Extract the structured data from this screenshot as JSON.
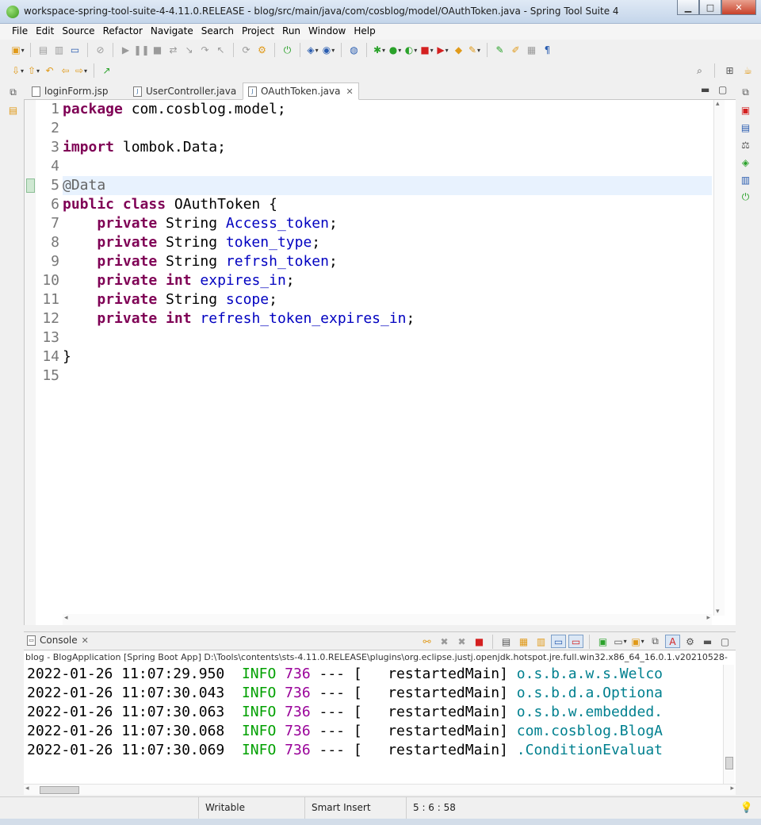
{
  "window": {
    "title": "workspace-spring-tool-suite-4-4.11.0.RELEASE - blog/src/main/java/com/cosblog/model/OAuthToken.java - Spring Tool Suite 4",
    "minimize": "0",
    "maximize": "□",
    "close": "✕"
  },
  "menu": [
    "File",
    "Edit",
    "Source",
    "Refactor",
    "Navigate",
    "Search",
    "Project",
    "Run",
    "Window",
    "Help"
  ],
  "editor": {
    "tabs": [
      {
        "label": "loginForm.jsp",
        "active": false
      },
      {
        "label": "UserController.java",
        "active": false
      },
      {
        "label": "OAuthToken.java",
        "active": true
      }
    ],
    "current_line": 5,
    "lines": [
      {
        "n": "1",
        "tokens": [
          {
            "t": "package",
            "c": "kw"
          },
          {
            "t": " com.cosblog.model;",
            "c": ""
          }
        ]
      },
      {
        "n": "2",
        "tokens": []
      },
      {
        "n": "3",
        "tokens": [
          {
            "t": "import",
            "c": "kw"
          },
          {
            "t": " lombok.Data;",
            "c": ""
          }
        ]
      },
      {
        "n": "4",
        "tokens": []
      },
      {
        "n": "5",
        "tokens": [
          {
            "t": "@Data",
            "c": "ann"
          }
        ]
      },
      {
        "n": "6",
        "tokens": [
          {
            "t": "public",
            "c": "kw"
          },
          {
            "t": " ",
            "c": ""
          },
          {
            "t": "class",
            "c": "kw"
          },
          {
            "t": " OAuthToken {",
            "c": ""
          }
        ]
      },
      {
        "n": "7",
        "tokens": [
          {
            "t": "    ",
            "c": ""
          },
          {
            "t": "private",
            "c": "kw"
          },
          {
            "t": " String ",
            "c": ""
          },
          {
            "t": "Access_token",
            "c": "fld"
          },
          {
            "t": ";",
            "c": ""
          }
        ]
      },
      {
        "n": "8",
        "tokens": [
          {
            "t": "    ",
            "c": ""
          },
          {
            "t": "private",
            "c": "kw"
          },
          {
            "t": " String ",
            "c": ""
          },
          {
            "t": "token_type",
            "c": "fld"
          },
          {
            "t": ";",
            "c": ""
          }
        ]
      },
      {
        "n": "9",
        "tokens": [
          {
            "t": "    ",
            "c": ""
          },
          {
            "t": "private",
            "c": "kw"
          },
          {
            "t": " String ",
            "c": ""
          },
          {
            "t": "refrsh_token",
            "c": "fld"
          },
          {
            "t": ";",
            "c": ""
          }
        ]
      },
      {
        "n": "10",
        "tokens": [
          {
            "t": "    ",
            "c": ""
          },
          {
            "t": "private",
            "c": "kw"
          },
          {
            "t": " ",
            "c": ""
          },
          {
            "t": "int",
            "c": "kw"
          },
          {
            "t": " ",
            "c": ""
          },
          {
            "t": "expires_in",
            "c": "fld"
          },
          {
            "t": ";",
            "c": ""
          }
        ]
      },
      {
        "n": "11",
        "tokens": [
          {
            "t": "    ",
            "c": ""
          },
          {
            "t": "private",
            "c": "kw"
          },
          {
            "t": " String ",
            "c": ""
          },
          {
            "t": "scope",
            "c": "fld"
          },
          {
            "t": ";",
            "c": ""
          }
        ]
      },
      {
        "n": "12",
        "tokens": [
          {
            "t": "    ",
            "c": ""
          },
          {
            "t": "private",
            "c": "kw"
          },
          {
            "t": " ",
            "c": ""
          },
          {
            "t": "int",
            "c": "kw"
          },
          {
            "t": " ",
            "c": ""
          },
          {
            "t": "refresh_token_expires_in",
            "c": "fld"
          },
          {
            "t": ";",
            "c": ""
          }
        ]
      },
      {
        "n": "13",
        "tokens": []
      },
      {
        "n": "14",
        "tokens": [
          {
            "t": "}",
            "c": ""
          }
        ]
      },
      {
        "n": "15",
        "tokens": []
      }
    ]
  },
  "console": {
    "tab_label": "Console",
    "launch_path": "blog - BlogApplication [Spring Boot App] D:\\Tools\\contents\\sts-4.11.0.RELEASE\\plugins\\org.eclipse.justj.openjdk.hotspot.jre.full.win32.x86_64_16.0.1.v20210528-",
    "lines": [
      {
        "ts": "2022-01-26 11:07:29.950",
        "level": "INFO",
        "pid": "736",
        "sep": "--- [",
        "thread": "  restartedMain]",
        "logger": "o.s.b.a.w.s.Welco"
      },
      {
        "ts": "2022-01-26 11:07:30.043",
        "level": "INFO",
        "pid": "736",
        "sep": "--- [",
        "thread": "  restartedMain]",
        "logger": "o.s.b.d.a.Optiona"
      },
      {
        "ts": "2022-01-26 11:07:30.063",
        "level": "INFO",
        "pid": "736",
        "sep": "--- [",
        "thread": "  restartedMain]",
        "logger": "o.s.b.w.embedded."
      },
      {
        "ts": "2022-01-26 11:07:30.068",
        "level": "INFO",
        "pid": "736",
        "sep": "--- [",
        "thread": "  restartedMain]",
        "logger": "com.cosblog.BlogA"
      },
      {
        "ts": "2022-01-26 11:07:30.069",
        "level": "INFO",
        "pid": "736",
        "sep": "--- [",
        "thread": "  restartedMain]",
        "logger": ".ConditionEvaluat"
      }
    ]
  },
  "status": {
    "writable": "Writable",
    "insert_mode": "Smart Insert",
    "position": "5 : 6 : 58"
  }
}
